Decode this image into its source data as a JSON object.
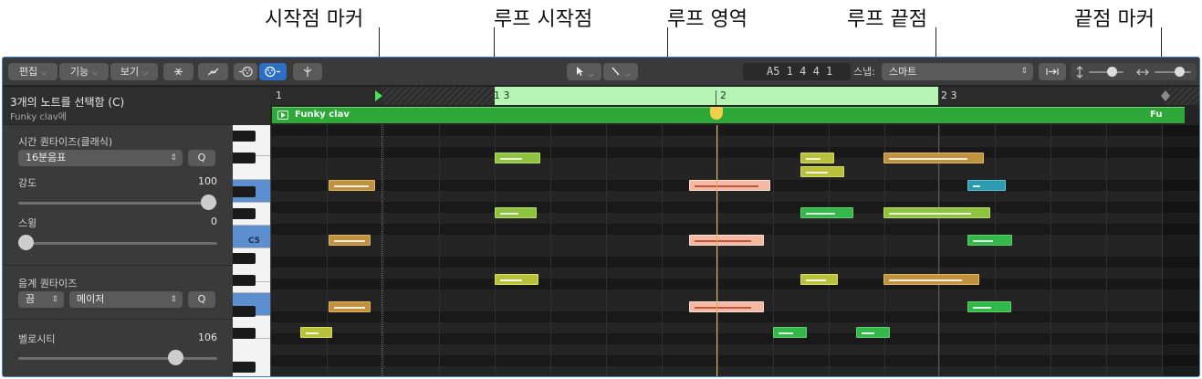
{
  "callouts": {
    "start_marker": "시작점 마커",
    "loop_start": "루프 시작점",
    "loop_region": "루프 영역",
    "loop_end": "루프 끝점",
    "end_marker": "끝점 마커"
  },
  "toolbar": {
    "edit_label": "편집",
    "functions_label": "기능",
    "view_label": "보기",
    "position_display": "A5  1 4 4 1",
    "snap_label": "스냅:",
    "snap_value": "스마트"
  },
  "inspector": {
    "selection_title": "3개의 노트를 선택함 (C)",
    "region_subtitle": "Funky clav에",
    "time_quantize_label": "시간 퀀타이즈(클래식)",
    "time_quantize_value": "16분음표",
    "q_button": "Q",
    "strength_label": "강도",
    "strength_value": "100",
    "strength_level": 1.0,
    "swing_label": "스윙",
    "swing_value": "0",
    "swing_level": 0.0,
    "scale_quantize_label": "음계 퀀타이즈",
    "scale_off_value": "끔",
    "scale_type_value": "메이저",
    "velocity_label": "벨로시티",
    "velocity_value": "106",
    "velocity_level": 0.83
  },
  "piano": {
    "c5_label": "C5"
  },
  "ruler": {
    "bar1": "1",
    "loop_start_pos": "1 3",
    "bar2": "2",
    "loop_end_pos": "2 3"
  },
  "region": {
    "name": "Funky clav",
    "name_truncated": "Fu"
  }
}
